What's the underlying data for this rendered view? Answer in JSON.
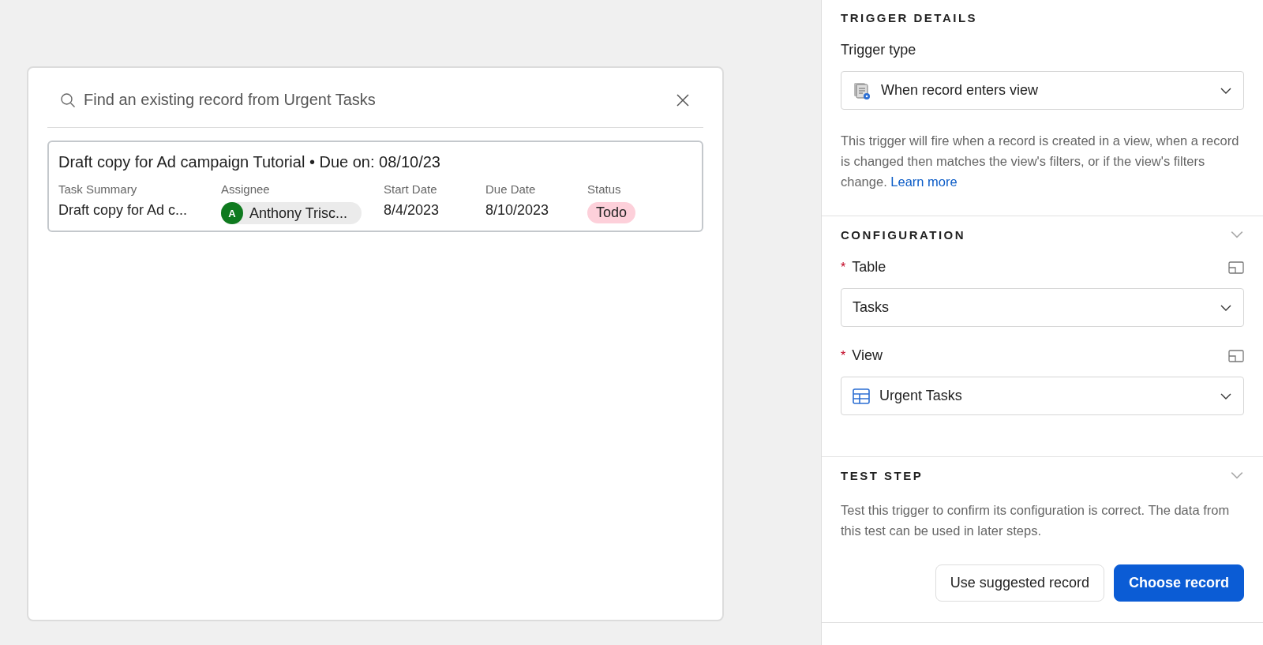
{
  "record_picker": {
    "search": {
      "placeholder": "Find an existing record from Urgent Tasks"
    },
    "records": [
      {
        "title": "Draft copy for Ad campaign Tutorial • Due on: 08/10/23",
        "selected": true,
        "fields": [
          {
            "kind": "text",
            "label": "Task Summary",
            "value": "Draft copy for Ad c..."
          },
          {
            "kind": "user",
            "label": "Assignee",
            "value": "Anthony Trisc...",
            "initial": "A",
            "color": "#0f7a1f"
          },
          {
            "kind": "text",
            "label": "Start Date",
            "value": "8/4/2023"
          },
          {
            "kind": "text",
            "label": "Due Date",
            "value": "8/10/2023"
          },
          {
            "kind": "tag",
            "label": "Status",
            "value": "Todo",
            "color": "#fdd0da"
          }
        ]
      }
    ]
  },
  "panel": {
    "sections": [
      {
        "kind": "trigger",
        "title": "TRIGGER DETAILS",
        "collapsible": false,
        "label": "Trigger type",
        "value": "When record enters view",
        "description": "This trigger will fire when a record is created in a view, when a record is changed then matches the view's filters, or if the view's filters change.",
        "link": "Learn more"
      },
      {
        "kind": "config",
        "title": "CONFIGURATION",
        "collapsible": true,
        "fields": [
          {
            "kind": "table",
            "label": "Table",
            "required_mark": "*",
            "value": "Tasks"
          },
          {
            "kind": "view",
            "label": "View",
            "required_mark": "*",
            "value": "Urgent Tasks"
          }
        ]
      },
      {
        "kind": "test",
        "title": "TEST STEP",
        "collapsible": true,
        "description": "Test this trigger to confirm its configuration is correct. The data from this test can be used in later steps.",
        "buttons": [
          {
            "label": "Use suggested record",
            "primary": false
          },
          {
            "label": "Choose record",
            "primary": true
          }
        ]
      }
    ]
  }
}
